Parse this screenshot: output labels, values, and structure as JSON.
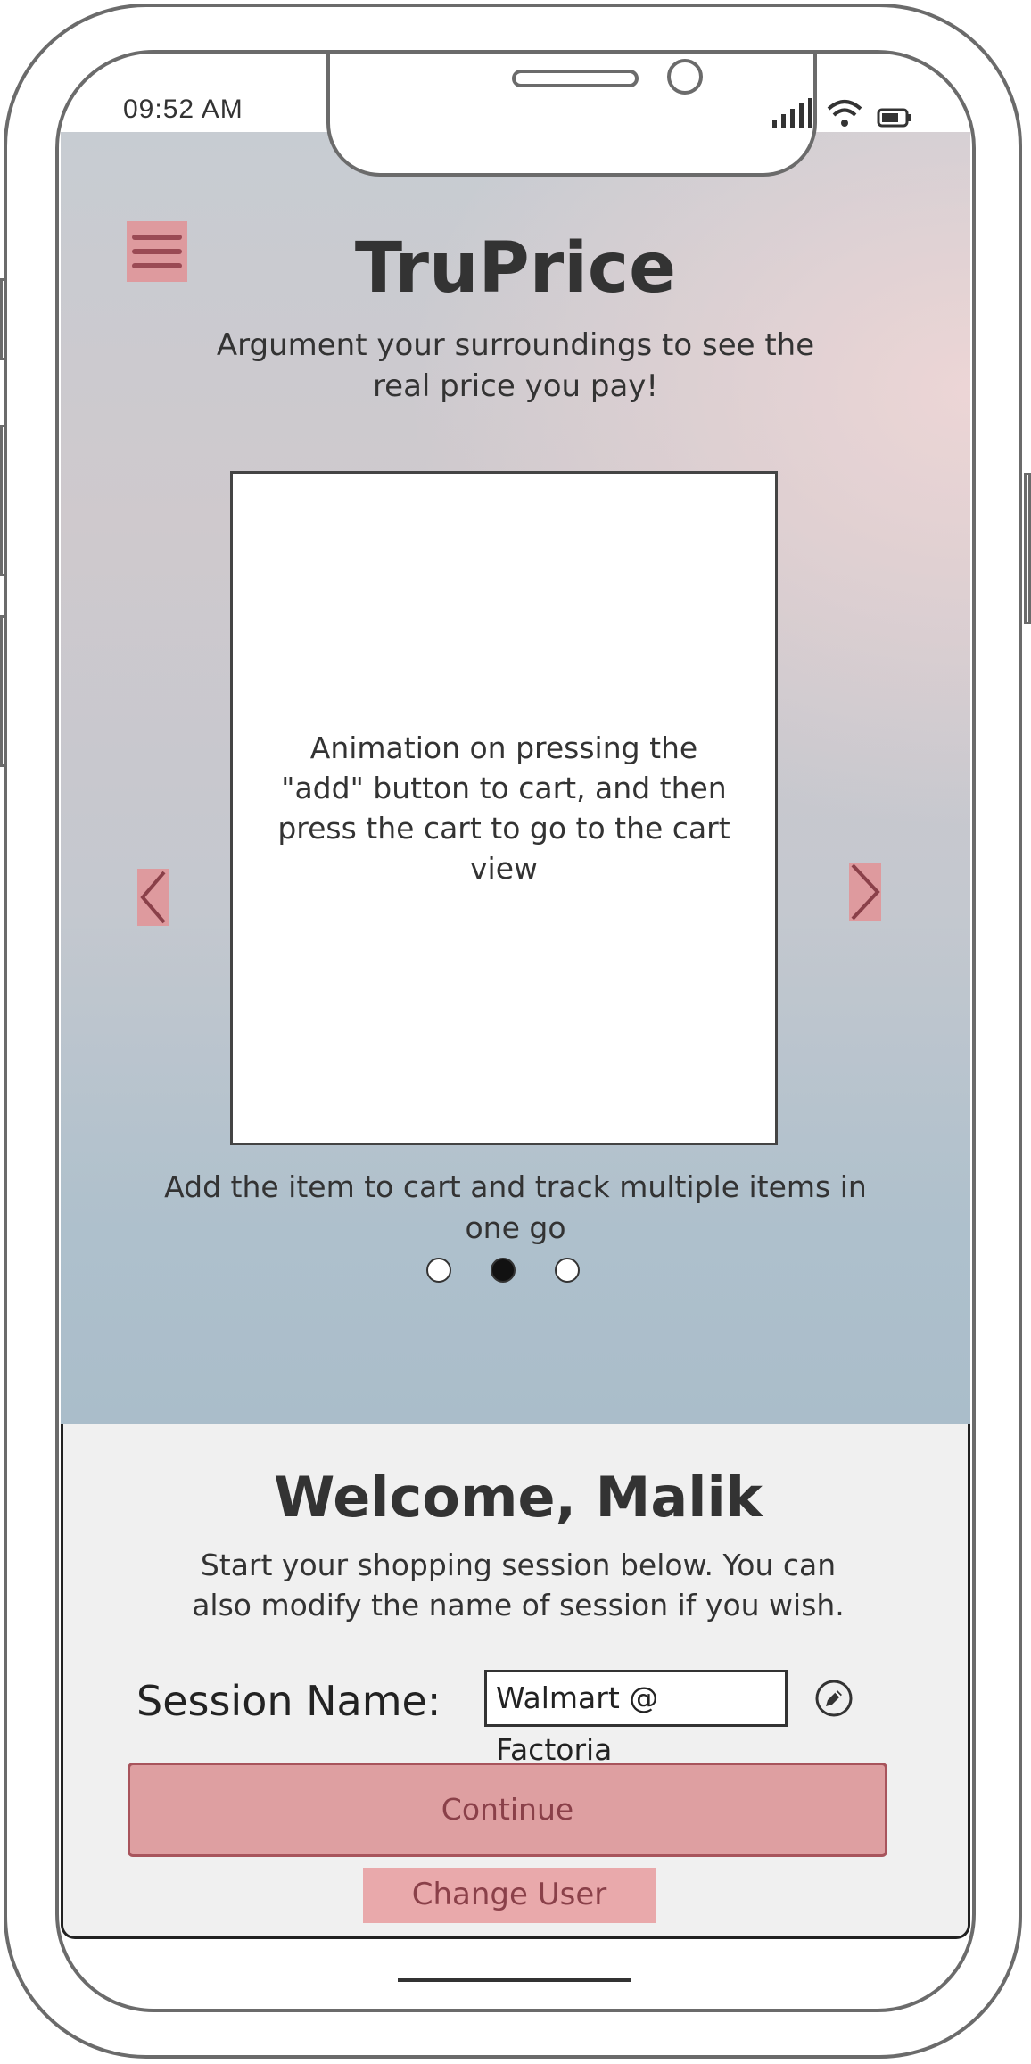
{
  "status_bar": {
    "time": "09:52 AM"
  },
  "app": {
    "title": "TruPrice",
    "tagline": "Argument your surroundings to see the real price you pay!"
  },
  "carousel": {
    "preview_text": "Animation on pressing the \"add\" button to cart, and then press the cart to go to the cart view",
    "caption": "Add the item to cart and track multiple items in one go",
    "page_count": 3,
    "active_page": 2
  },
  "welcome": {
    "heading": "Welcome, Malik",
    "subtext": "Start your shopping session below. You can also modify the name of session if you wish.",
    "session_label": "Session Name:",
    "session_value": "Walmart @ Factoria",
    "continue_label": "Continue",
    "change_user_label": "Change User"
  },
  "icons": {
    "menu": "hamburger-menu-icon",
    "prev": "chevron-left-icon",
    "next": "chevron-right-icon",
    "edit": "pencil-edit-icon",
    "signal": "cellular-signal-icon",
    "wifi": "wifi-icon",
    "battery": "battery-icon"
  },
  "colors": {
    "accent": "#de9a9e",
    "accent_dark": "#9a4a54",
    "panel_bg": "#f0f0f0"
  }
}
